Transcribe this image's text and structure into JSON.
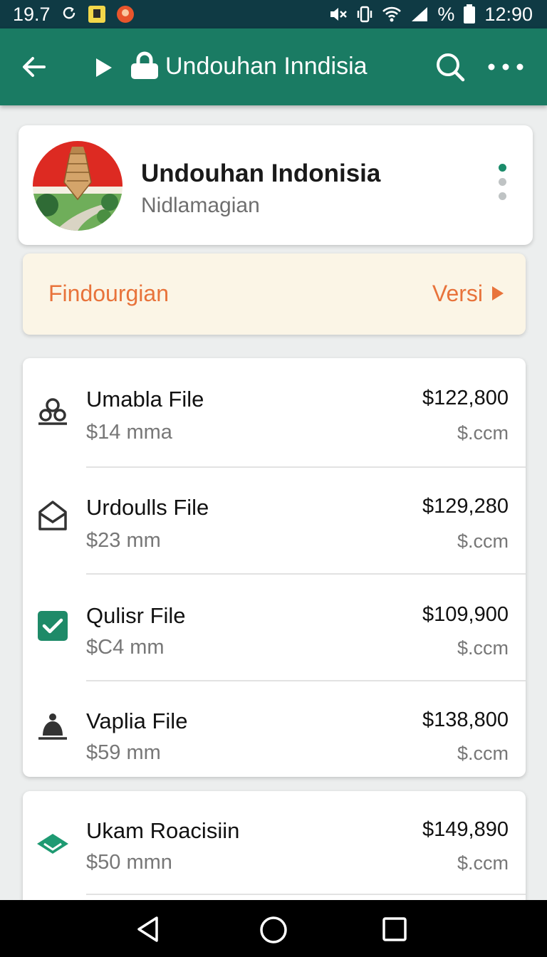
{
  "status_bar": {
    "left_text": "19.7",
    "battery_percent_text": "%",
    "time": "12:90",
    "icons": [
      "sync-icon",
      "notification-badge-icon",
      "app-notification-icon",
      "mute-icon",
      "vibrate-icon",
      "wifi-icon",
      "signal-icon",
      "battery-icon"
    ]
  },
  "app_bar": {
    "title": "Undouhan Inndisia",
    "icons": [
      "back-arrow-icon",
      "play-icon",
      "lock-icon",
      "search-icon",
      "more-horizontal-icon"
    ],
    "accent_color": "#1a7b63"
  },
  "header_card": {
    "title": "Undouhan Indonisia",
    "subtitle": "Nidlamagian",
    "page_dots": 3,
    "active_dot": 0
  },
  "banner": {
    "left_label": "Findourgian",
    "right_label": "Versi",
    "color": "#e8733b"
  },
  "files": [
    {
      "name": "Umabla File",
      "size": "$14 mma",
      "price": "$122,800",
      "suffix": "$.ccm",
      "icon": "users-icon"
    },
    {
      "name": "Urdoulls File",
      "size": "$23 mm",
      "price": "$129,280",
      "suffix": "$.ccm",
      "icon": "mail-icon"
    },
    {
      "name": "Qulisr File",
      "size": "$C4 mm",
      "price": "$109,900",
      "suffix": "$.ccm",
      "icon": "checkbox-checked-icon"
    },
    {
      "name": "Vaplia File",
      "size": "$59 mm",
      "price": "$138,800",
      "suffix": "$.ccm",
      "icon": "person-icon"
    }
  ],
  "files2": [
    {
      "name": "Ukam Roacisiin",
      "size": "$50 mmn",
      "price": "$149,890",
      "suffix": "$.ccm",
      "icon": "envelope-green-icon"
    }
  ],
  "nav_bar": {
    "icons": [
      "nav-back-icon",
      "nav-home-icon",
      "nav-recents-icon"
    ]
  }
}
